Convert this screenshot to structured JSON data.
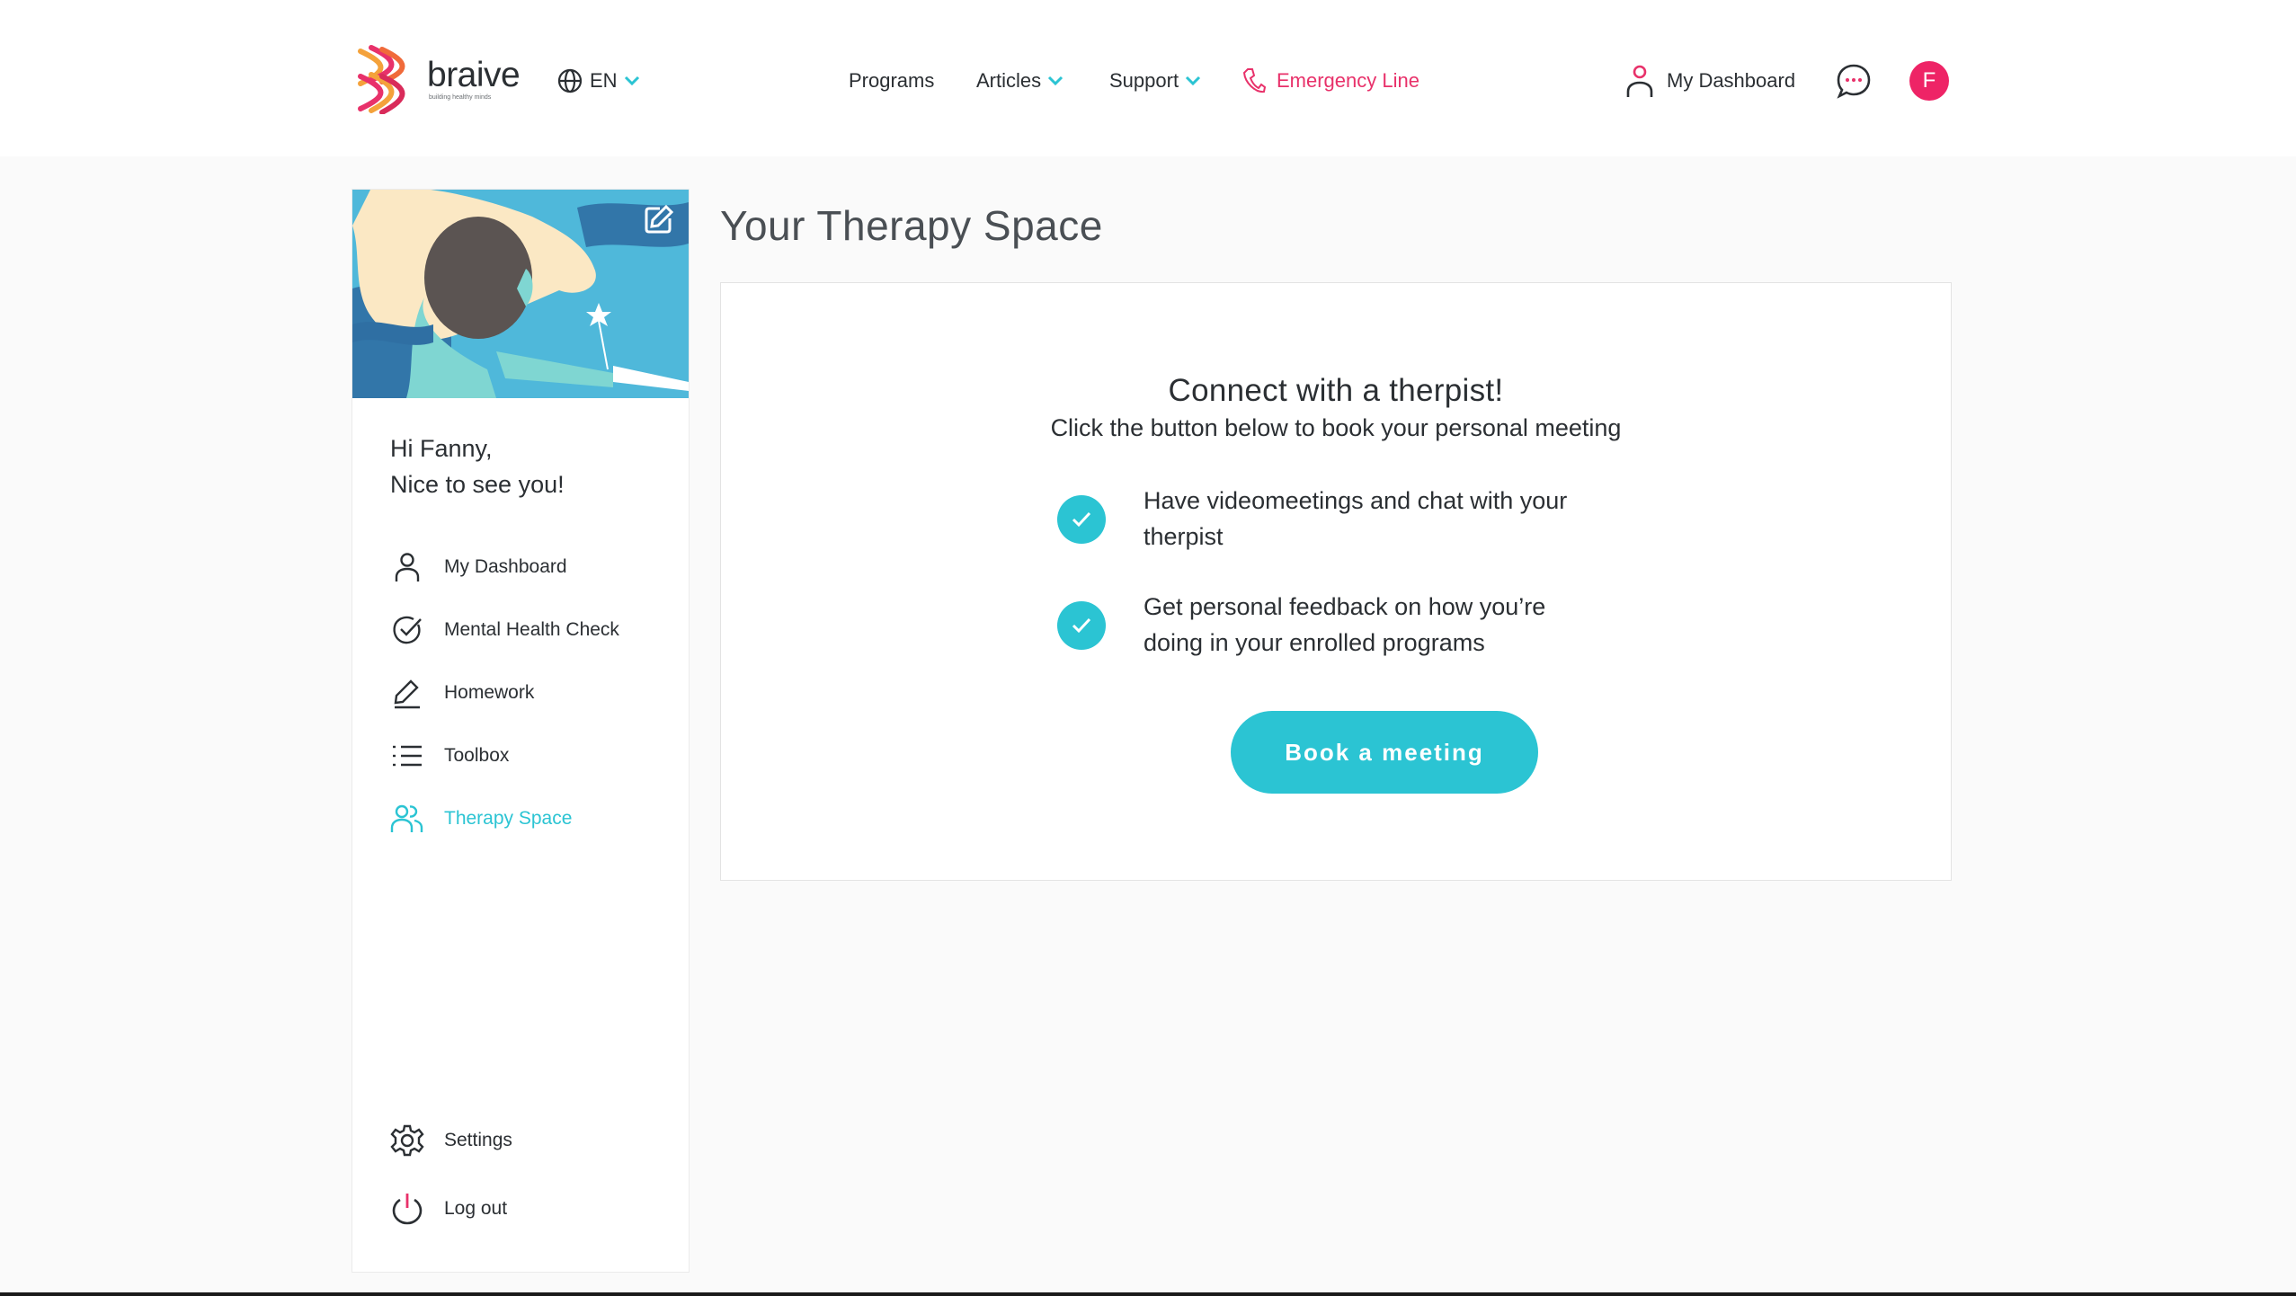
{
  "header": {
    "logo_word": "braive",
    "logo_tagline": "building healthy minds",
    "language": "EN",
    "nav": {
      "programs": "Programs",
      "articles": "Articles",
      "support": "Support",
      "emergency": "Emergency Line",
      "dashboard": "My Dashboard"
    },
    "avatar_initial": "F"
  },
  "sidebar": {
    "greeting_line1": "Hi Fanny,",
    "greeting_line2": "Nice to see you!",
    "items": [
      {
        "label": "My Dashboard",
        "icon": "user-icon"
      },
      {
        "label": "Mental Health Check",
        "icon": "check-circle-icon"
      },
      {
        "label": "Homework",
        "icon": "pencil-icon"
      },
      {
        "label": "Toolbox",
        "icon": "list-icon"
      },
      {
        "label": "Therapy Space",
        "icon": "users-icon",
        "active": true
      }
    ],
    "footer_items": [
      {
        "label": "Settings",
        "icon": "gear-icon"
      },
      {
        "label": "Log out",
        "icon": "power-icon"
      }
    ]
  },
  "main": {
    "title": "Your Therapy Space",
    "card": {
      "heading": "Connect with a therpist!",
      "subheading": "Click the button below to book your personal meeting",
      "features": [
        {
          "line1": "Have videomeetings and chat with your",
          "line2": "therpist"
        },
        {
          "line1": "Get personal feedback on how you’re",
          "line2": "doing in your enrolled programs"
        }
      ],
      "button_label": "Book a meeting"
    }
  },
  "colors": {
    "accent": "#2bc4d3",
    "brand_pink": "#ee2466",
    "emergency": "#e8316a",
    "banner_sky": "#4fb8da"
  }
}
